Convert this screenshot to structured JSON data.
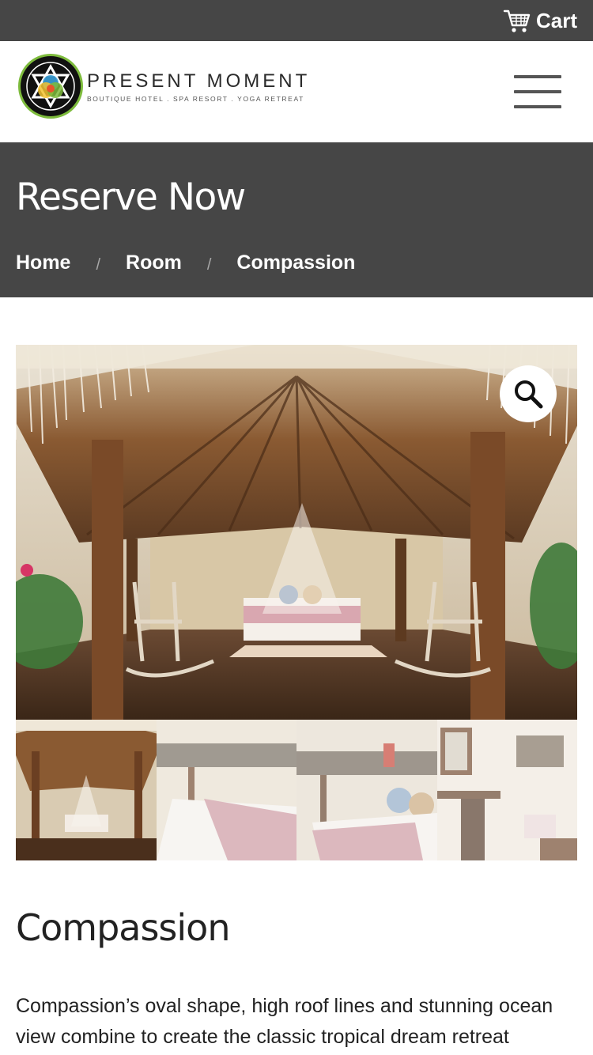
{
  "topbar": {
    "cart_label": "Cart",
    "cart_icon": "shopping-cart-icon"
  },
  "header": {
    "logo_title": "PRESENT MOMENT",
    "logo_subtitle": "BOUTIQUE HOTEL . SPA RESORT . YOGA RETREAT",
    "menu_icon": "hamburger-icon"
  },
  "hero": {
    "title": "Reserve Now",
    "breadcrumb": [
      "Home",
      "Room",
      "Compassion"
    ],
    "separator": "/"
  },
  "gallery": {
    "zoom_icon": "magnifier-icon",
    "thumbnail_count": 4
  },
  "product": {
    "title": "Compassion",
    "description": "Compassion’s oval shape, high roof lines and stunning ocean view combine to create the classic tropical dream retreat"
  },
  "colors": {
    "dark_bar": "#464646",
    "text": "#222222",
    "white": "#ffffff"
  }
}
